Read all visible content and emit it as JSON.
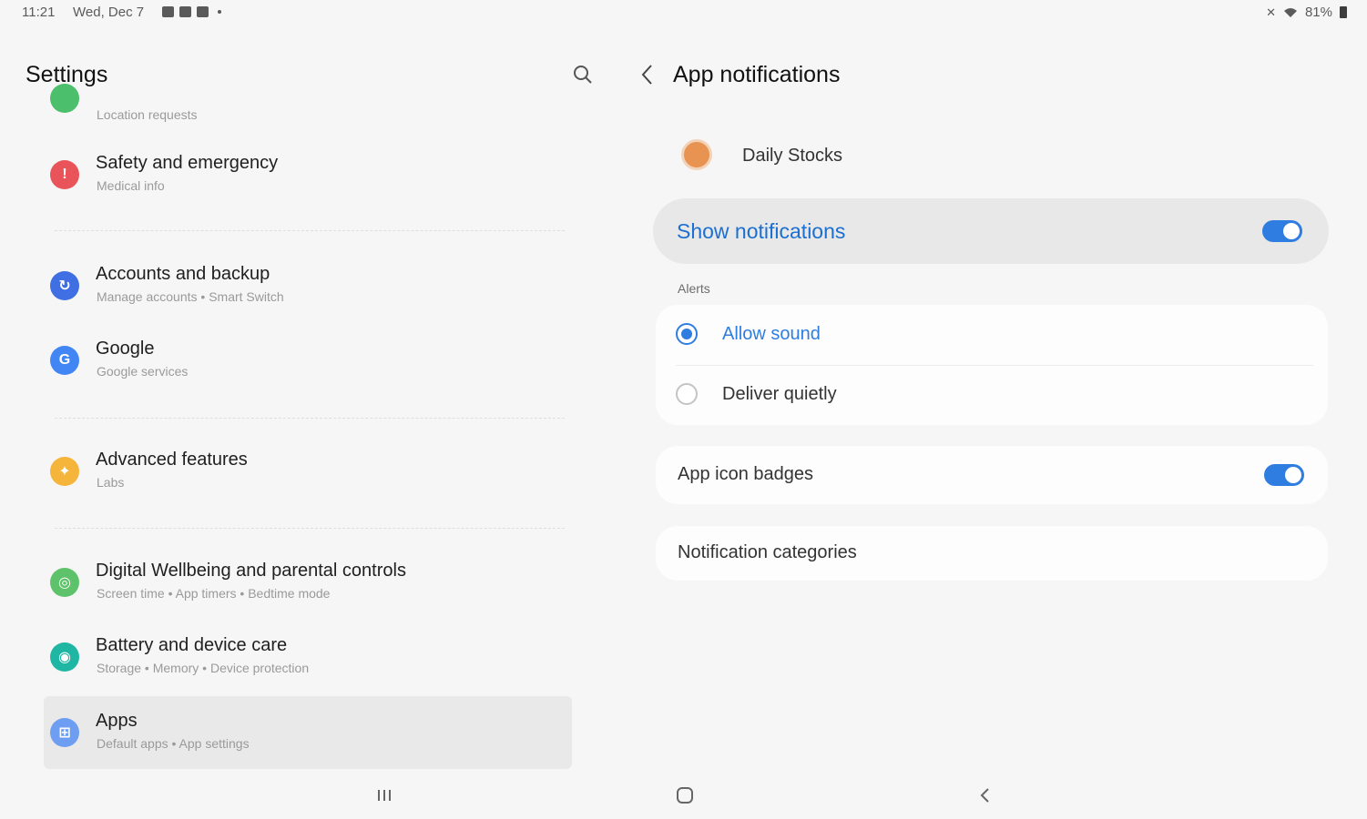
{
  "status_bar": {
    "time": "11:21",
    "date": "Wed, Dec 7",
    "battery": "81%"
  },
  "left_panel": {
    "title": "Settings",
    "partial_item": {
      "subtitle": "Location requests"
    },
    "items": [
      {
        "title": "Safety and emergency",
        "subtitle": "Medical info",
        "color": "#e9545a",
        "glyph": "!"
      },
      {
        "title": "Accounts and backup",
        "subtitle": "Manage accounts  •  Smart Switch",
        "color": "#3f6fe2",
        "glyph": "↻"
      },
      {
        "title": "Google",
        "subtitle": "Google services",
        "color": "#4285f4",
        "glyph": "G"
      },
      {
        "title": "Advanced features",
        "subtitle": "Labs",
        "color": "#f5b43a",
        "glyph": "✦"
      },
      {
        "title": "Digital Wellbeing and parental controls",
        "subtitle": "Screen time  •  App timers  •  Bedtime mode",
        "color": "#5dc26a",
        "glyph": "◎"
      },
      {
        "title": "Battery and device care",
        "subtitle": "Storage  •  Memory  •  Device protection",
        "color": "#1fb7a3",
        "glyph": "◉"
      },
      {
        "title": "Apps",
        "subtitle": "Default apps  •  App settings",
        "color": "#6d9ef2",
        "glyph": "⊞"
      }
    ]
  },
  "right_panel": {
    "title": "App notifications",
    "app_name": "Daily Stocks",
    "show_notifications": {
      "label": "Show notifications",
      "on": true
    },
    "alerts": {
      "label": "Alerts",
      "options": [
        {
          "label": "Allow sound",
          "selected": true
        },
        {
          "label": "Deliver quietly",
          "selected": false
        }
      ]
    },
    "app_icon_badges": {
      "label": "App icon badges",
      "on": true
    },
    "notification_categories": {
      "label": "Notification categories"
    }
  },
  "colors": {
    "accent": "#2f7de1",
    "background": "#f6f6f6",
    "selected_row": "#e9e9e9"
  }
}
